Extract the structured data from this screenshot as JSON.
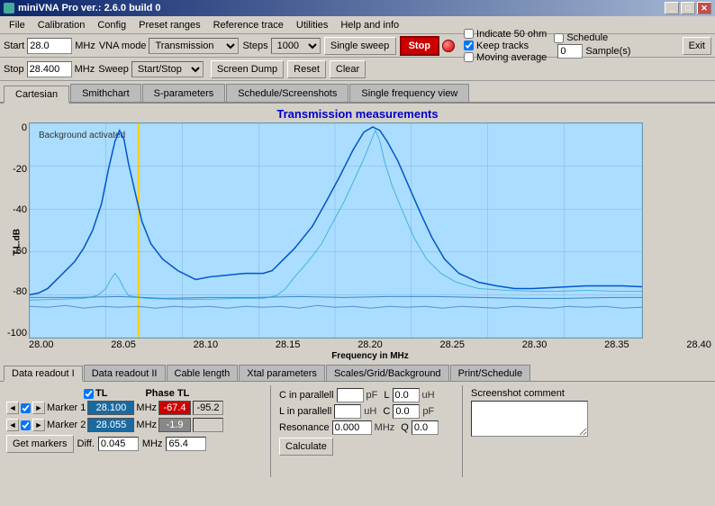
{
  "window": {
    "title": "miniVNA Pro ver.: 2.6.0 build 0"
  },
  "menu": {
    "items": [
      "File",
      "Calibration",
      "Config",
      "Preset ranges",
      "Reference trace",
      "Utilities",
      "Help and info"
    ]
  },
  "toolbar": {
    "start_label": "Start",
    "start_value": "28.0",
    "stop_label": "Stop",
    "stop_value": "28.400",
    "mhz": "MHz",
    "vna_mode_label": "VNA mode",
    "vna_mode_value": "Transmission",
    "sweep_label": "Sweep",
    "sweep_value": "Start/Stop",
    "steps_label": "Steps",
    "steps_value": "1000",
    "single_sweep": "Single sweep",
    "stop_btn": "Stop",
    "screen_dump": "Screen Dump",
    "reset": "Reset",
    "clear": "Clear",
    "exit": "Exit",
    "indicate_50ohm": "Indicate 50 ohm",
    "keep_tracks": "Keep tracks",
    "moving_average": "Moving average",
    "schedule": "Schedule",
    "samples_label": "Sample(s)",
    "samples_value": "0"
  },
  "main_tabs": [
    "Cartesian",
    "Smithchart",
    "S-parameters",
    "Schedule/Screenshots",
    "Single frequency view"
  ],
  "active_main_tab": 0,
  "chart": {
    "title": "Transmission measurements",
    "y_label": "T.L.dB",
    "y_ticks": [
      "0",
      "-20",
      "-40",
      "-60",
      "-80",
      "-100"
    ],
    "x_ticks": [
      "28.00",
      "28.05",
      "28.10",
      "28.15",
      "28.20",
      "28.25",
      "28.30",
      "28.35",
      "28.40"
    ],
    "x_label": "Frequency in MHz",
    "background_text": "Background activated"
  },
  "bottom_tabs": [
    "Data readout I",
    "Data readout II",
    "Cable length",
    "Xtal parameters",
    "Scales/Grid/Background",
    "Print/Schedule"
  ],
  "active_bottom_tab": 0,
  "data_readout": {
    "tl_header": "TL",
    "phase_tl_header": "Phase TL",
    "markers": [
      {
        "label": "Marker 1",
        "freq": "28.100",
        "mhz": "MHz",
        "tl": "-67.4",
        "phase": "-95.2"
      },
      {
        "label": "Marker 2",
        "freq": "28.055",
        "mhz": "MHz",
        "tl": "-1.9",
        "phase": ""
      }
    ],
    "get_markers": "Get markers",
    "diff_label": "Diff.",
    "diff_value": "0.045",
    "diff_mhz": "MHz",
    "diff_phase": "65.4"
  },
  "cable_length": {
    "c_parallel_label": "C in parallell",
    "c_parallel_unit": "pF",
    "l_parallel_label": "L in parallell",
    "l_parallel_unit": "uH",
    "resonance_label": "Resonance",
    "resonance_value": "0.000",
    "resonance_unit": "MHz",
    "l_value": "0.0",
    "l_unit": "uH",
    "c_value": "0.0",
    "c_unit": "pF",
    "q_label": "Q",
    "q_value": "0.0",
    "calculate": "Calculate"
  },
  "screenshot": {
    "label": "Screenshot comment"
  },
  "win_buttons": [
    "_",
    "□",
    "✕"
  ]
}
